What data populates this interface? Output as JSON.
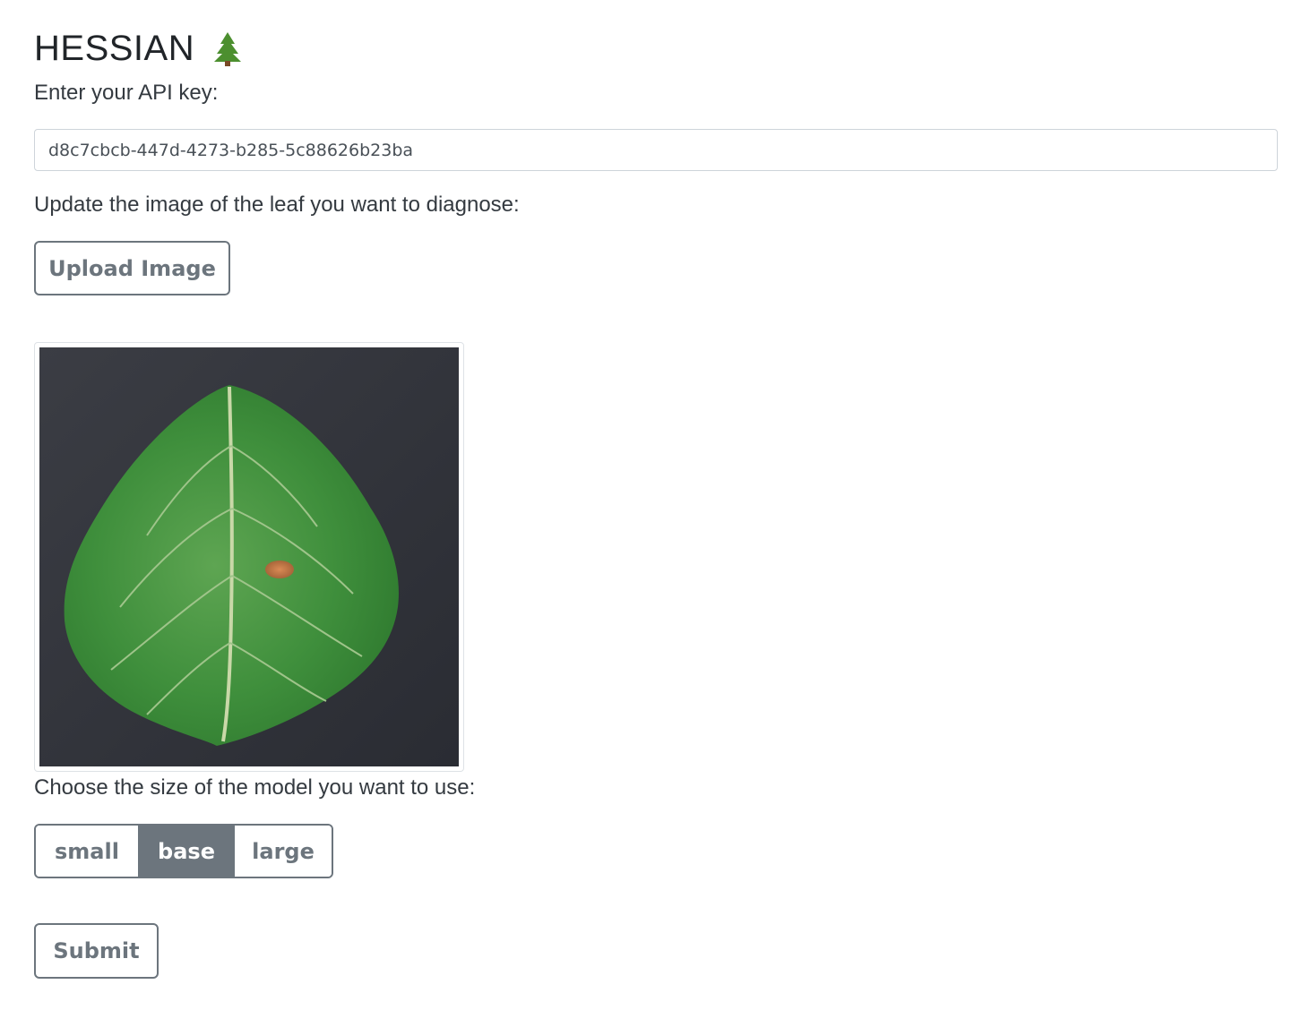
{
  "header": {
    "title": "HESSIAN",
    "icon": "evergreen-tree-icon"
  },
  "api": {
    "label": "Enter your API key:",
    "value": "d8c7cbcb-447d-4273-b285-5c88626b23ba"
  },
  "upload": {
    "label": "Update the image of the leaf you want to diagnose:",
    "button_label": "Upload Image"
  },
  "preview": {
    "image": "leaf-photo"
  },
  "model": {
    "label": "Choose the size of the model you want to use:",
    "options": [
      "small",
      "base",
      "large"
    ],
    "selected": "base"
  },
  "submit": {
    "label": "Submit"
  },
  "colors": {
    "secondary": "#6c757d",
    "input_border": "#ced4da",
    "tree_green": "#4c8f2f"
  }
}
